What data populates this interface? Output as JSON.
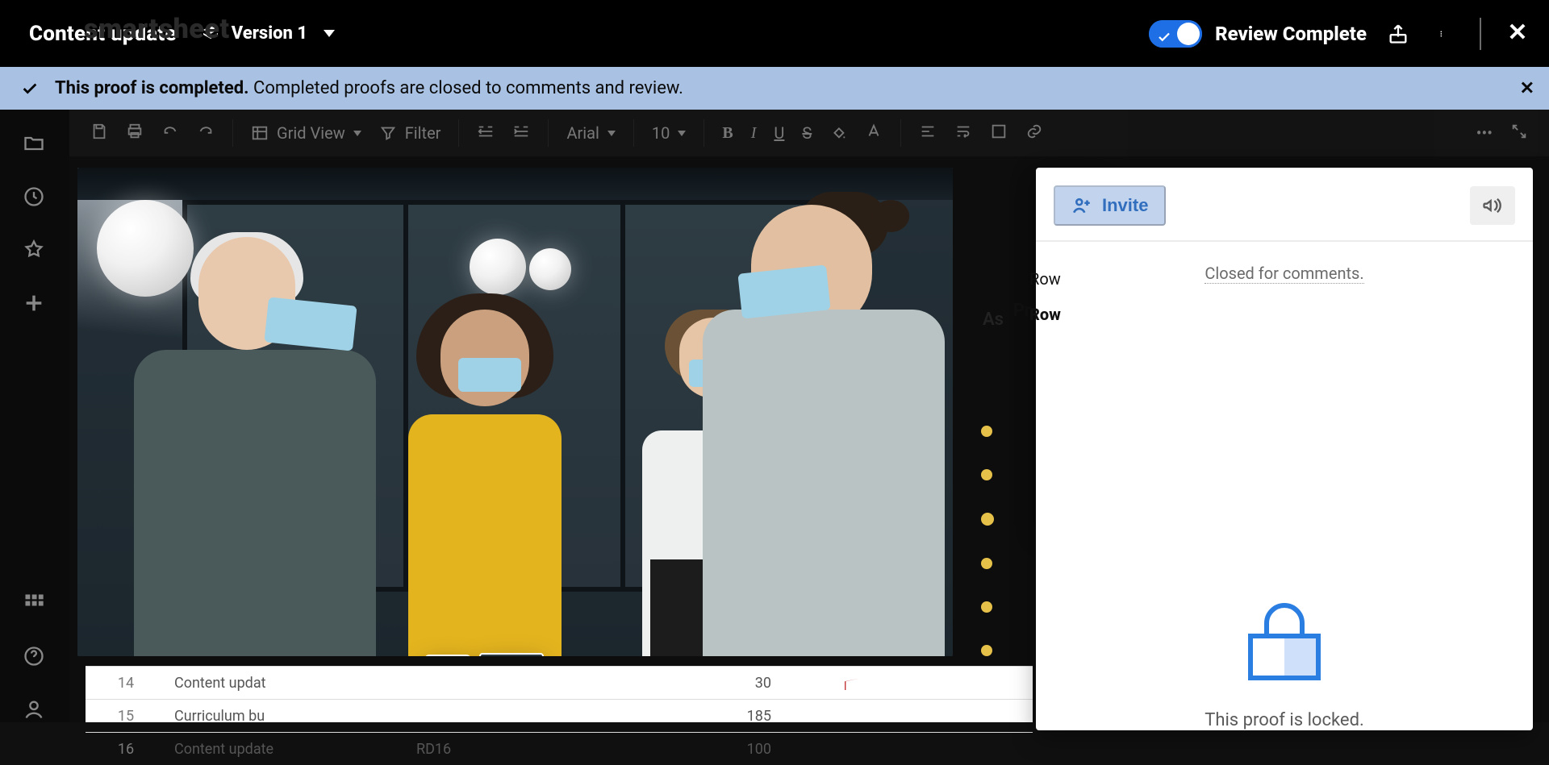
{
  "brand_hidden": "smartsheet",
  "header": {
    "title": "Content update",
    "version_label": "Version 1",
    "review_label": "Review Complete",
    "share_icon": "share-icon",
    "more_icon": "more-icon",
    "close_icon": "close-icon"
  },
  "banner": {
    "strong": "This proof is completed.",
    "rest": "Completed proofs are closed to comments and review."
  },
  "toolbar": {
    "view_label": "Grid View",
    "filter_label": "Filter",
    "font_label": "Arial",
    "size_label": "10"
  },
  "bg": {
    "as_label": "As",
    "pr_label": "Pr",
    "row_label": "Row",
    "row_bold": "Row",
    "rows": [
      {
        "num": "14",
        "name": "Content updat",
        "col3": "",
        "val": "30",
        "flag": true
      },
      {
        "num": "15",
        "name": "Curriculum bu",
        "col3": "",
        "val": "185",
        "flag": false
      },
      {
        "num": "16",
        "name": "Content update",
        "col3": "RD16",
        "val": "100",
        "flag": false
      }
    ]
  },
  "panel": {
    "invite_label": "Invite",
    "locked_text": "This proof is locked.",
    "footer_text": "Closed for comments.",
    "feedback_icon": "megaphone-icon"
  },
  "thumbs": {
    "add_label": "+"
  }
}
